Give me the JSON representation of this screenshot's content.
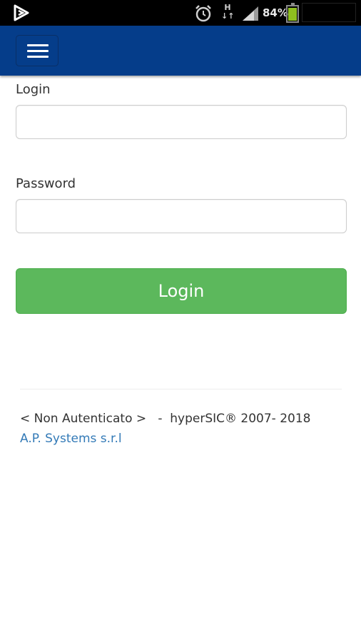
{
  "status_bar": {
    "network_label_top": "H",
    "network_label_bottom": "↓↑",
    "battery_percent": "84%",
    "battery_level": 0.84
  },
  "navbar": {
    "menu_icon": "hamburger-menu-icon",
    "color": "#053d8a"
  },
  "form": {
    "login_label": "Login",
    "login_value": "",
    "password_label": "Password",
    "password_value": "",
    "submit_label": "Login",
    "submit_color": "#5cb85c"
  },
  "footer": {
    "status_text": "< Non Autenticato >   -  hyperSIC® 2007- 2018",
    "company_link": "A.P. Systems s.r.l",
    "link_color": "#337ab7"
  }
}
